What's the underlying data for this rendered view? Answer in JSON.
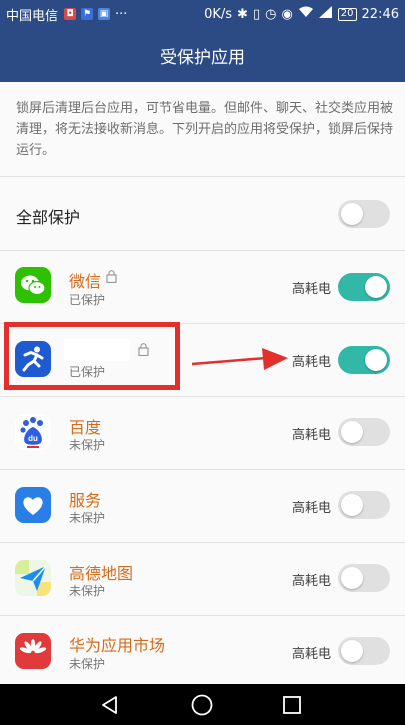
{
  "status_bar": {
    "carrier": "中国电信",
    "speed": "0K/s",
    "battery": "20",
    "time": "22:46"
  },
  "title": "受保护应用",
  "description": "锁屏后清理后台应用，可节省电量。但邮件、聊天、社交类应用被清理，将无法接收新消息。下列开启的应用将受保护，锁屏后保持运行。",
  "protect_all": {
    "label": "全部保护",
    "enabled": false
  },
  "apps": [
    {
      "name": "微信",
      "status": "已保护",
      "power_label": "高耗电",
      "enabled": true,
      "locked": true,
      "icon": "wechat-icon"
    },
    {
      "name": "",
      "status": "已保护",
      "power_label": "高耗电",
      "enabled": true,
      "locked": true,
      "icon": "runner-icon"
    },
    {
      "name": "百度",
      "status": "未保护",
      "power_label": "高耗电",
      "enabled": false,
      "locked": false,
      "icon": "baidu-icon"
    },
    {
      "name": "服务",
      "status": "未保护",
      "power_label": "高耗电",
      "enabled": false,
      "locked": false,
      "icon": "heart-icon"
    },
    {
      "name": "高德地图",
      "status": "未保护",
      "power_label": "高耗电",
      "enabled": false,
      "locked": false,
      "icon": "amap-icon"
    },
    {
      "name": "华为应用市场",
      "status": "未保护",
      "power_label": "高耗电",
      "enabled": false,
      "locked": false,
      "icon": "huawei-icon"
    }
  ],
  "colors": {
    "header": "#2c4a83",
    "toggle_on": "#32b8a7",
    "app_name": "#d66b19",
    "annotation": "#e3302d"
  }
}
